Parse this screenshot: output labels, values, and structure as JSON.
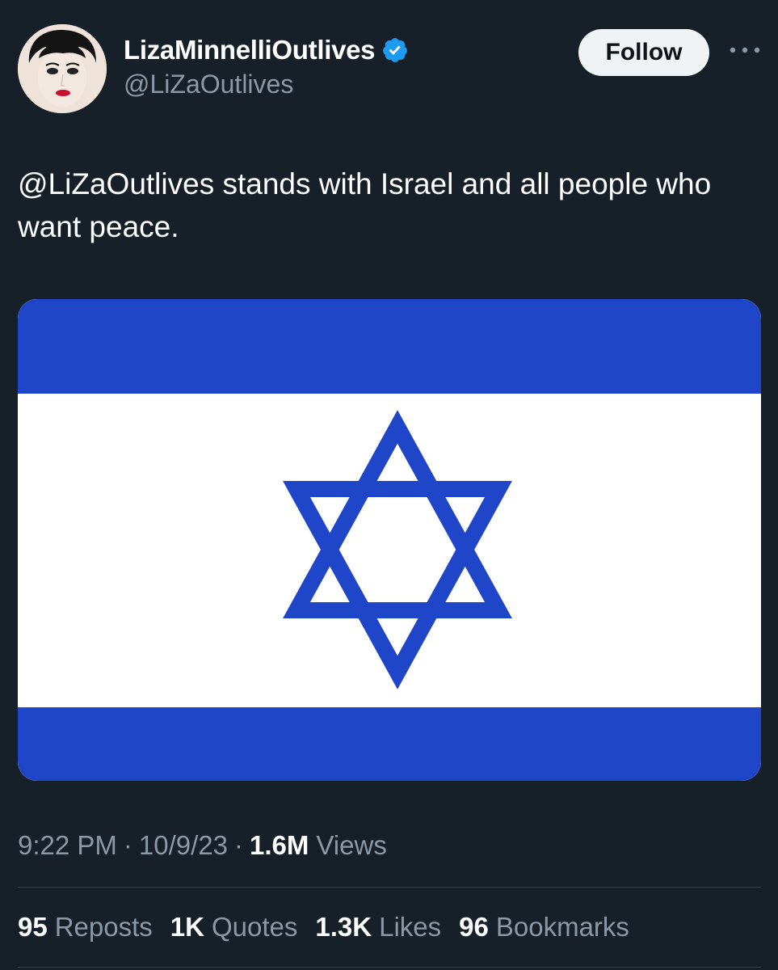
{
  "author": {
    "display_name": "LizaMinnelliOutlives",
    "handle": "@LiZaOutlives",
    "verified_icon": "verified-badge-icon",
    "avatar": "avatar"
  },
  "actions": {
    "follow_label": "Follow",
    "more_icon": "more-options-icon"
  },
  "tweet": {
    "text": "@LiZaOutlives stands with Israel and all people who want peace.",
    "media": {
      "description_icon": "israel-flag-image",
      "colors": {
        "blue": "#1f45c9",
        "white": "#ffffff"
      }
    }
  },
  "meta": {
    "time": "9:22 PM",
    "separator": "·",
    "date": "10/9/23",
    "views_count": "1.6M",
    "views_label": "Views"
  },
  "stats": [
    {
      "count": "95",
      "label": "Reposts"
    },
    {
      "count": "1K",
      "label": "Quotes"
    },
    {
      "count": "1.3K",
      "label": "Likes"
    },
    {
      "count": "96",
      "label": "Bookmarks"
    }
  ],
  "colors": {
    "background": "#171f29",
    "secondary_text": "#8b98a5",
    "verified_blue": "#1d9bf0",
    "button_bg": "#eff3f4"
  }
}
